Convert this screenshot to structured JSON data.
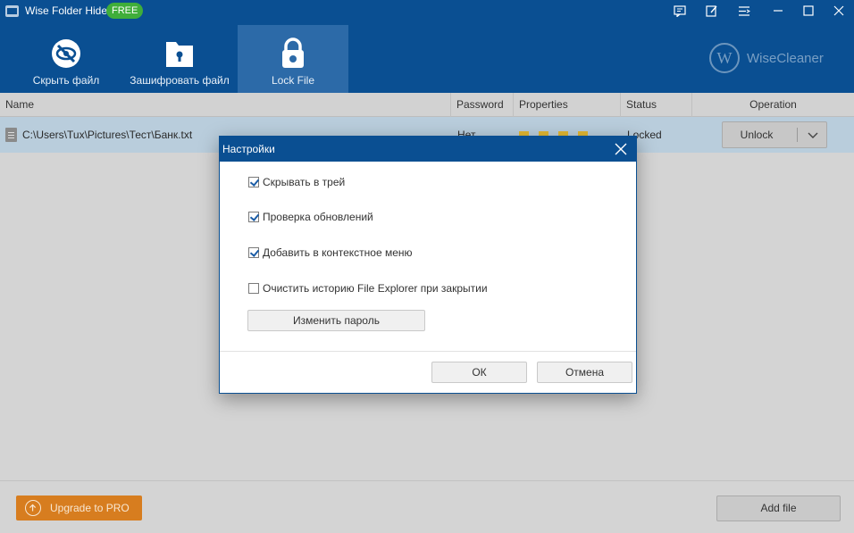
{
  "window": {
    "title": "Wise Folder Hider",
    "badge": "FREE"
  },
  "toolbar": {
    "items": [
      {
        "label": "Скрыть файл",
        "icon": "eye-slash-icon"
      },
      {
        "label": "Зашифровать файл",
        "icon": "lock-folder-icon"
      },
      {
        "label": "Lock File",
        "icon": "padlock-icon",
        "active": true
      }
    ],
    "brand": "WiseCleaner",
    "brand_logo_letter": "W"
  },
  "table": {
    "columns": [
      "Name",
      "Password",
      "Properties",
      "Status",
      "Operation"
    ],
    "rows": [
      {
        "name": "C:\\Users\\Tux\\Pictures\\Тест\\Банк.txt",
        "password": "Нет",
        "status": "Locked",
        "operation": "Unlock"
      }
    ]
  },
  "footer": {
    "upgrade_label": "Upgrade to PRO",
    "add_file_label": "Add file"
  },
  "dialog": {
    "title": "Настройки",
    "options": [
      {
        "label": "Скрывать в трей",
        "checked": true
      },
      {
        "label": "Проверка обновлений",
        "checked": true
      },
      {
        "label": "Добавить в контекстное меню",
        "checked": true
      },
      {
        "label": "Очистить историю File Explorer при закрытии",
        "checked": false
      }
    ],
    "change_password_label": "Изменить пароль",
    "ok_label": "ОК",
    "cancel_label": "Отмена"
  },
  "colors": {
    "primary": "#0a4f92",
    "accent": "#d77d1f",
    "badge": "#3fae3a",
    "selected_row": "#b9cddc"
  }
}
